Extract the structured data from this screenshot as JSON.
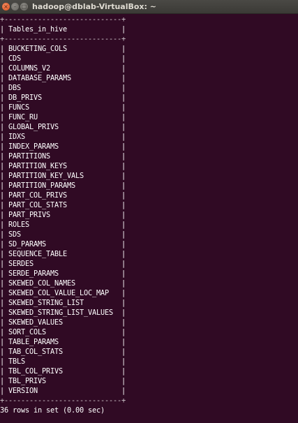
{
  "window": {
    "title": "hadoop@dblab-VirtualBox: ~",
    "close_glyph": "×",
    "minimize_glyph": "–",
    "maximize_glyph": "□"
  },
  "terminal": {
    "separator": "+----------------------------+",
    "header_line": "| Tables_in_hive             |",
    "rows": [
      "| BUCKETING_COLS             |",
      "| CDS                        |",
      "| COLUMNS_V2                 |",
      "| DATABASE_PARAMS            |",
      "| DBS                        |",
      "| DB_PRIVS                   |",
      "| FUNCS                      |",
      "| FUNC_RU                    |",
      "| GLOBAL_PRIVS               |",
      "| IDXS                       |",
      "| INDEX_PARAMS               |",
      "| PARTITIONS                 |",
      "| PARTITION_KEYS             |",
      "| PARTITION_KEY_VALS         |",
      "| PARTITION_PARAMS           |",
      "| PART_COL_PRIVS             |",
      "| PART_COL_STATS             |",
      "| PART_PRIVS                 |",
      "| ROLES                      |",
      "| SDS                        |",
      "| SD_PARAMS                  |",
      "| SEQUENCE_TABLE             |",
      "| SERDES                     |",
      "| SERDE_PARAMS               |",
      "| SKEWED_COL_NAMES           |",
      "| SKEWED_COL_VALUE_LOC_MAP   |",
      "| SKEWED_STRING_LIST         |",
      "| SKEWED_STRING_LIST_VALUES  |",
      "| SKEWED_VALUES              |",
      "| SORT_COLS                  |",
      "| TABLE_PARAMS               |",
      "| TAB_COL_STATS              |",
      "| TBLS                       |",
      "| TBL_COL_PRIVS              |",
      "| TBL_PRIVS                  |",
      "| VERSION                    |"
    ],
    "footer": "36 rows in set (0.00 sec)"
  }
}
